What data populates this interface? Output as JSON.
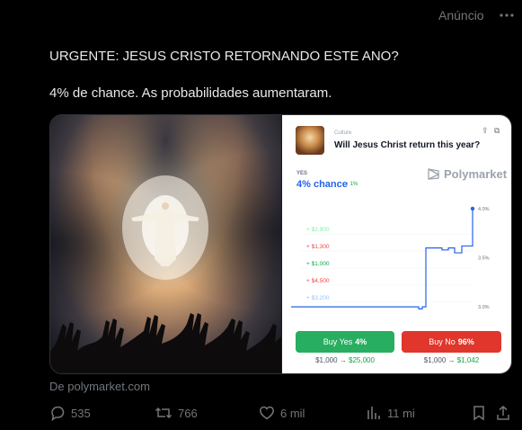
{
  "ad": {
    "label": "Anúncio"
  },
  "tweet": {
    "line1": "URGENTE: JESUS CRISTO RETORNANDO ESTE ANO?",
    "line2": "4% de chance. As probabilidades aumentaram."
  },
  "card": {
    "category": "Culture",
    "question": "Will Jesus Christ return this year?",
    "yes_label": "YES",
    "chance": "4% chance",
    "delta": "↑ 1%",
    "brand": "Polymarket",
    "buy_yes_label": "Buy Yes",
    "buy_yes_value": "4%",
    "buy_no_label": "Buy No",
    "buy_no_value": "96%",
    "yes_payout_from": "$1,000",
    "yes_payout_to": "$25,000",
    "no_payout_from": "$1,000",
    "no_payout_to": "$1,042"
  },
  "chart_data": {
    "type": "line",
    "series": [
      {
        "values": [
          3.0,
          3.0,
          3.0,
          3.0,
          3.0,
          3.0,
          3.0,
          2.98,
          3.0,
          3.6,
          3.6,
          3.58,
          3.6,
          3.55,
          3.62,
          3.62,
          4.0
        ]
      }
    ],
    "y_ticks": [
      "4.0%",
      "3.5%",
      "3.0%"
    ],
    "ylim": [
      2.8,
      4.1
    ],
    "trade_labels": [
      {
        "text": "+ $2,900",
        "color": "#86efac"
      },
      {
        "text": "+ $1,300",
        "color": "#ef4444"
      },
      {
        "text": "+ $1,000",
        "color": "#16a34a"
      },
      {
        "text": "+ $4,500",
        "color": "#ef4444"
      },
      {
        "text": "+ $3,200",
        "color": "#93c5fd"
      }
    ],
    "line_color": "#2563eb"
  },
  "source": {
    "text": "De polymarket.com"
  },
  "actions": {
    "replies": "535",
    "reposts": "766",
    "likes": "6 mil",
    "views": "11 mi"
  },
  "icons": [
    "more-icon",
    "share-icon",
    "link-icon",
    "polymarket-logo-icon",
    "reply-icon",
    "repost-icon",
    "like-icon",
    "views-icon",
    "bookmark-icon",
    "share-post-icon"
  ]
}
